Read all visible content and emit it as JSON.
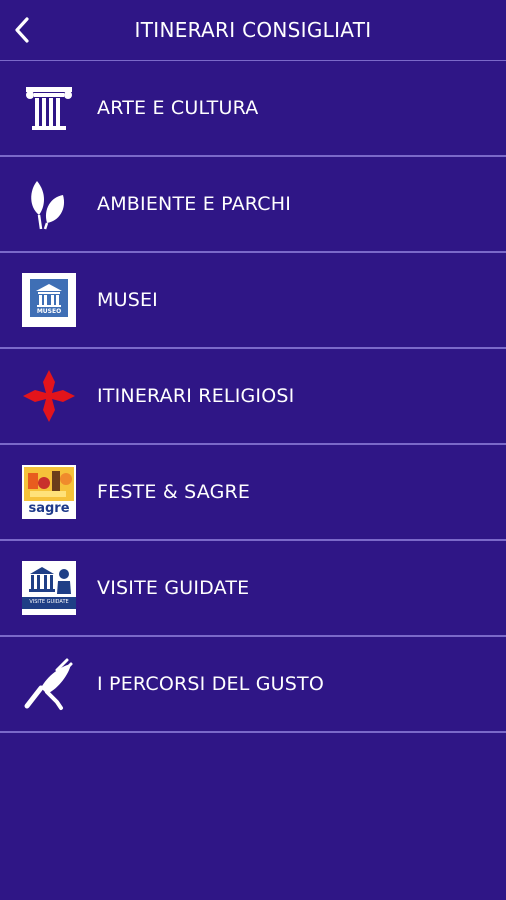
{
  "header": {
    "title": "ITINERARI CONSIGLIATI"
  },
  "menu": {
    "items": [
      {
        "label": "ARTE E CULTURA",
        "icon": "column-icon"
      },
      {
        "label": "AMBIENTE E PARCHI",
        "icon": "leaves-icon"
      },
      {
        "label": "MUSEI",
        "icon": "museum-icon"
      },
      {
        "label": "ITINERARI RELIGIOSI",
        "icon": "red-cross-icon"
      },
      {
        "label": "FESTE & SAGRE",
        "icon": "sagre-icon"
      },
      {
        "label": "VISITE GUIDATE",
        "icon": "guided-visits-icon"
      },
      {
        "label": "I PERCORSI DEL GUSTO",
        "icon": "food-icon"
      }
    ]
  },
  "icon_text": {
    "museo": "MUSEO",
    "sagre": "sagre",
    "visite": "VISITE GUIDATE"
  },
  "colors": {
    "background": "#2f1686",
    "divider": "#7b69c9",
    "cross": "#e3141b",
    "icon_blue": "#3f6fb5"
  }
}
